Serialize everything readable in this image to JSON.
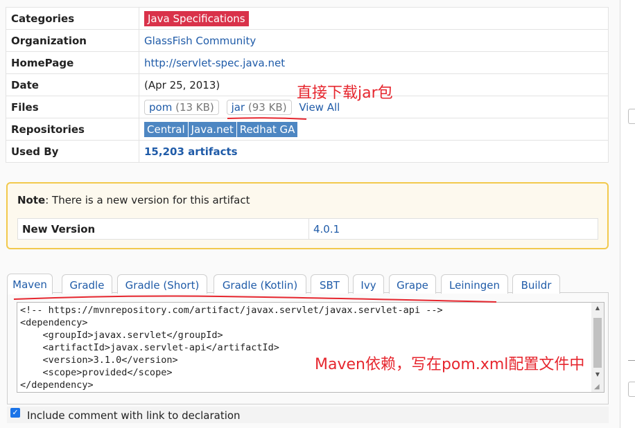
{
  "artifact_info": {
    "rows": [
      {
        "key": "Categories",
        "value": "Java Specifications"
      },
      {
        "key": "Organization",
        "value": "GlassFish Community"
      },
      {
        "key": "HomePage",
        "value": "http://servlet-spec.java.net"
      },
      {
        "key": "Date",
        "value": "(Apr 25, 2013)"
      },
      {
        "key": "Files",
        "pom": "pom",
        "pom_size": "(13 KB)",
        "jar": "jar",
        "jar_size": "(93 KB)",
        "view_all": "View All"
      },
      {
        "key": "Repositories",
        "repos": [
          "Central",
          "Java.net",
          "Redhat GA"
        ]
      },
      {
        "key": "Used By",
        "value": "15,203 artifacts"
      }
    ]
  },
  "note": {
    "label": "Note",
    "text": ": There is a new version for this artifact",
    "new_version_key": "New Version",
    "new_version_value": "4.0.1"
  },
  "tabs": [
    "Maven",
    "Gradle",
    "Gradle (Short)",
    "Gradle (Kotlin)",
    "SBT",
    "Ivy",
    "Grape",
    "Leiningen",
    "Buildr"
  ],
  "active_tab": "Maven",
  "code_snippet": "<!-- https://mvnrepository.com/artifact/javax.servlet/javax.servlet-api -->\n<dependency>\n    <groupId>javax.servlet</groupId>\n    <artifactId>javax.servlet-api</artifactId>\n    <version>3.1.0</version>\n    <scope>provided</scope>\n</dependency>",
  "include_comment_label": "Include comment with link to declaration",
  "annotations": {
    "jar_note": "直接下载jar包",
    "maven_note": "Maven依赖，写在pom.xml配置文件中"
  },
  "colors": {
    "category_badge": "#d9324a",
    "repo_badge": "#4d86c2",
    "link": "#1f5ba8",
    "note_border": "#f2c94c",
    "annotation": "#e6262e"
  }
}
